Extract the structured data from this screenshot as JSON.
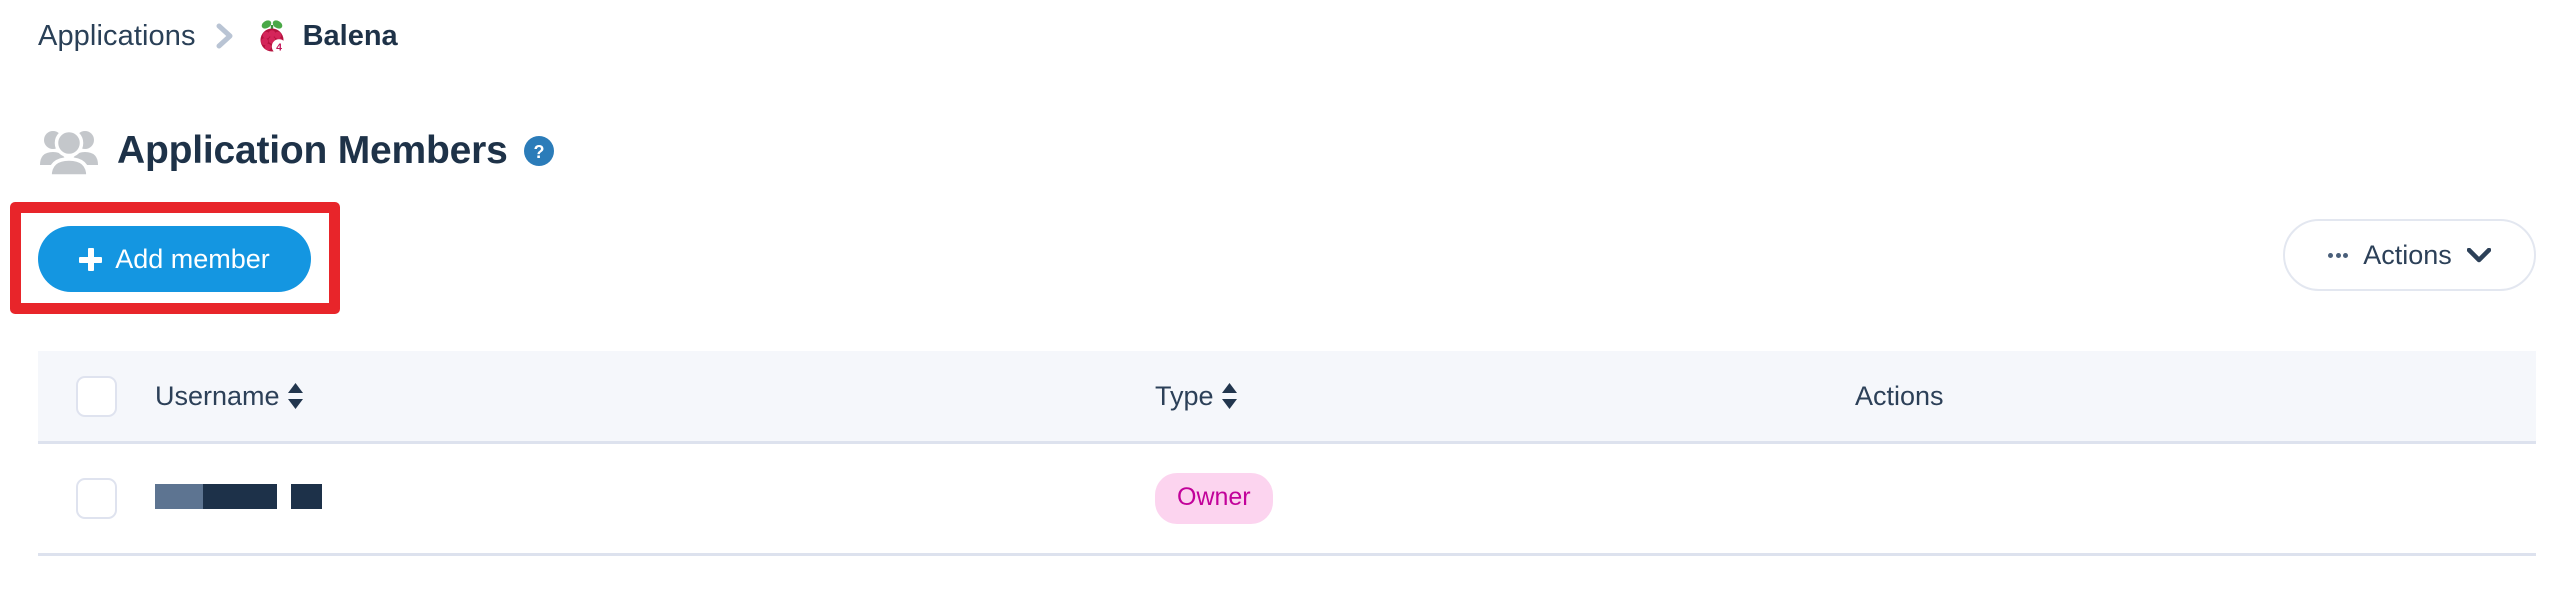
{
  "breadcrumb": {
    "parent_label": "Applications",
    "separator_icon": "chevron-right-icon",
    "current_icon": "raspberry-pi-4-icon",
    "current_badge": "4",
    "current_label": "Balena"
  },
  "header": {
    "icon": "users-group-icon",
    "title": "Application Members",
    "help_icon": "help-circle-icon"
  },
  "toolbar": {
    "add_member_icon": "plus-icon",
    "add_member_label": "Add member",
    "actions_icon": "ellipsis-icon",
    "actions_label": "Actions",
    "actions_chevron_icon": "chevron-down-icon"
  },
  "highlight": {
    "color": "#e8252a",
    "target": "add-member-button"
  },
  "table": {
    "select_all_checkbox": "",
    "columns": [
      {
        "key": "username",
        "label": "Username",
        "sortable": true,
        "sort_icon": "sort-arrows-icon"
      },
      {
        "key": "type",
        "label": "Type",
        "sortable": true,
        "sort_icon": "sort-arrows-icon"
      },
      {
        "key": "actions",
        "label": "Actions",
        "sortable": false
      }
    ],
    "rows": [
      {
        "checked": false,
        "username": "",
        "username_redacted": true,
        "type": "Owner",
        "type_badge_bg": "#fcd4ef",
        "type_badge_fg": "#c2029a",
        "actions": ""
      }
    ]
  },
  "colors": {
    "primary": "#1496e1",
    "text": "#2c4058",
    "table_header_bg": "#f5f7fb",
    "border": "#dde2ee",
    "highlight": "#e8252a"
  }
}
